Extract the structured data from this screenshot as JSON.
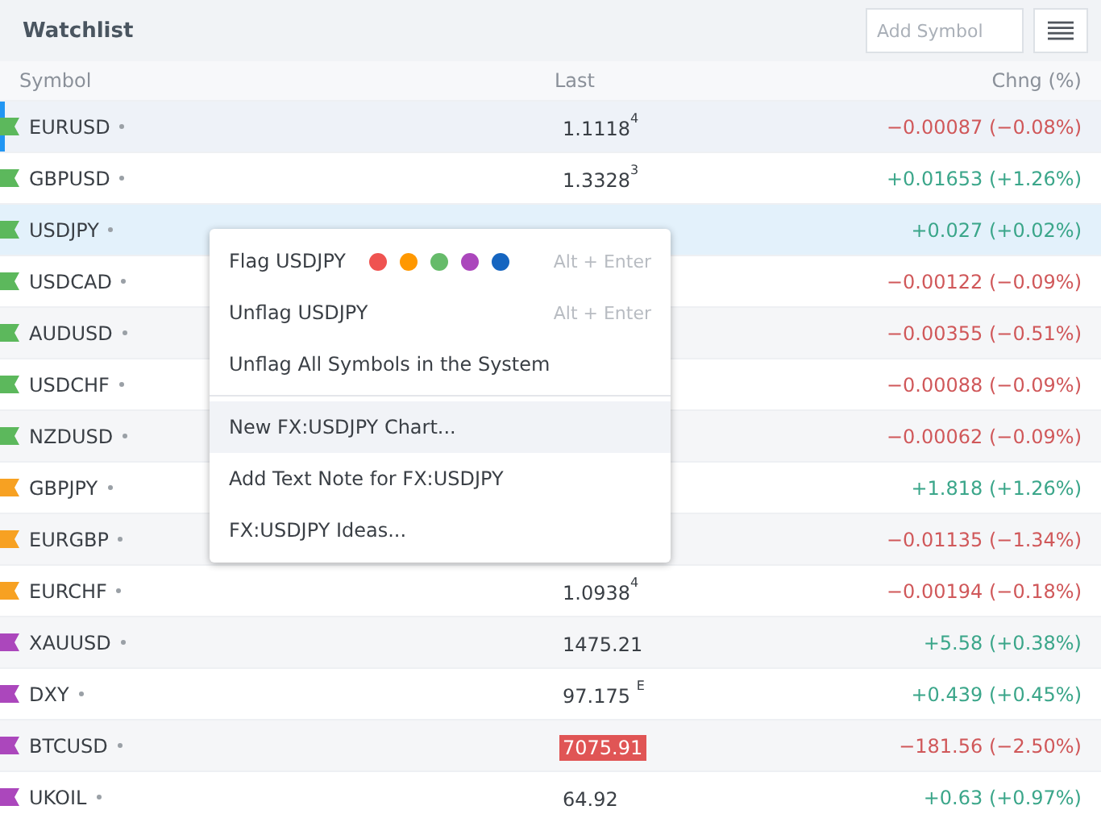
{
  "header": {
    "title": "Watchlist",
    "add_symbol": {
      "placeholder": "Add Symbol"
    }
  },
  "columns": [
    "Symbol",
    "Last",
    "Chng (%)"
  ],
  "rows": [
    {
      "symbol": "EURUSD",
      "color": "#5cb85c",
      "selected": true,
      "highlighted": false,
      "last": "1.1118$^{4}$",
      "last_flash": false,
      "change": "−0.00087 (−0.08%)",
      "kind": "down"
    },
    {
      "symbol": "GBPUSD",
      "color": "#5cb85c",
      "selected": false,
      "highlighted": false,
      "last": "1.3328$^{3}$",
      "last_flash": false,
      "change": "+0.01653 (+1.26%)",
      "kind": "up"
    },
    {
      "symbol": "USDJPY",
      "color": "#5cb85c",
      "selected": false,
      "highlighted": true,
      "change": "+0.027 (+0.02%)",
      "kind": "up"
    },
    {
      "symbol": "USDCAD",
      "color": "#5cb85c",
      "selected": false,
      "highlighted": false,
      "change": "−0.00122 (−0.09%)",
      "kind": "down"
    },
    {
      "symbol": "AUDUSD",
      "color": "#5cb85c",
      "selected": false,
      "highlighted": false,
      "change": "−0.00355 (−0.51%)",
      "kind": "down"
    },
    {
      "symbol": "USDCHF",
      "color": "#5cb85c",
      "selected": false,
      "highlighted": false,
      "change": "−0.00088 (−0.09%)",
      "kind": "down"
    },
    {
      "symbol": "NZDUSD",
      "color": "#5cb85c",
      "selected": false,
      "highlighted": false,
      "change": "−0.00062 (−0.09%)",
      "kind": "down"
    },
    {
      "symbol": "GBPJPY",
      "color": "#f7a122",
      "selected": false,
      "highlighted": false,
      "change": "+1.818 (+1.26%)",
      "kind": "up"
    },
    {
      "symbol": "EURGBP",
      "color": "#f7a122",
      "selected": false,
      "highlighted": false,
      "change": "−0.01135 (−1.34%)",
      "kind": "down"
    },
    {
      "symbol": "EURCHF",
      "color": "#f7a122",
      "selected": false,
      "highlighted": false,
      "last": "1.0938$^{4}$",
      "last_flash": false,
      "change": "−0.00194 (−0.18%)",
      "kind": "down"
    },
    {
      "symbol": "XAUUSD",
      "color": "#ab47bc",
      "selected": false,
      "highlighted": false,
      "last": "1475.21",
      "last_flash": false,
      "change": "+5.58 (+0.38%)",
      "kind": "up"
    },
    {
      "symbol": "DXY",
      "color": "#ab47bc",
      "selected": false,
      "highlighted": false,
      "last": "97.175 $^{E}$",
      "last_flash": false,
      "change": "+0.439 (+0.45%)",
      "kind": "up"
    },
    {
      "symbol": "BTCUSD",
      "color": "#ab47bc",
      "selected": false,
      "highlighted": false,
      "last": "7075.91",
      "last_flash": true,
      "change": "−181.56 (−2.50%)",
      "kind": "down"
    },
    {
      "symbol": "UKOIL",
      "color": "#ab47bc",
      "selected": false,
      "highlighted": false,
      "last": "64.92",
      "last_flash": false,
      "change": "+0.63 (+0.97%)",
      "kind": "up"
    }
  ],
  "context_menu": {
    "items": [
      {
        "kind": "flag",
        "label": "Flag USDJPY",
        "flag_colors": [
          {
            "color": "#ef5350"
          },
          {
            "color": "#ff9800"
          },
          {
            "color": "#66bb6a"
          },
          {
            "color": "#ab47bc"
          },
          {
            "color": "#1565c0"
          }
        ],
        "shortcut": "Alt + Enter",
        "selected": false
      },
      {
        "kind": "item",
        "label": "Unflag USDJPY",
        "shortcut": "Alt + Enter",
        "selected": false
      },
      {
        "kind": "item",
        "label": "Unflag All Symbols in the System",
        "selected": false
      },
      {
        "kind": "divider"
      },
      {
        "kind": "item",
        "label": "New FX:USDJPY Chart...",
        "selected": true
      },
      {
        "kind": "item",
        "label": "Add Text Note for FX:USDJPY",
        "selected": false
      },
      {
        "kind": "item",
        "label": "FX:USDJPY Ideas...",
        "selected": false
      }
    ]
  }
}
